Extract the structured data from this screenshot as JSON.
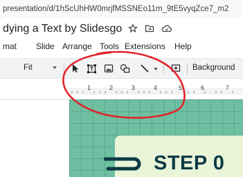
{
  "browser": {
    "url": "presentation/d/1hScUhHW0mrjfMSSNEo11m_9tE5vyqZce7_m2"
  },
  "app": {
    "doc_title": "dying a Text by Slidesgo",
    "title_icons": [
      "star-icon",
      "move-to-folder-icon",
      "cloud-status-icon"
    ]
  },
  "menu": {
    "items": [
      "mat",
      "Slide",
      "Arrange",
      "Tools",
      "Extensions",
      "Help"
    ]
  },
  "toolbar": {
    "zoom": "Fit",
    "tools": [
      "select-arrow-icon",
      "text-box-icon",
      "image-icon",
      "shape-icon",
      "line-icon"
    ],
    "background_label": "Background"
  },
  "ruler": {
    "labels": [
      "1",
      "2",
      "3",
      "4",
      "5",
      "6",
      "7"
    ]
  },
  "slide": {
    "heading": "STEP 0",
    "accent_color": "#6fbfa2",
    "text_color": "#0d3b44"
  },
  "annotation": {
    "color": "#e0242b",
    "shape": "hand-drawn circle around toolbar tools"
  }
}
